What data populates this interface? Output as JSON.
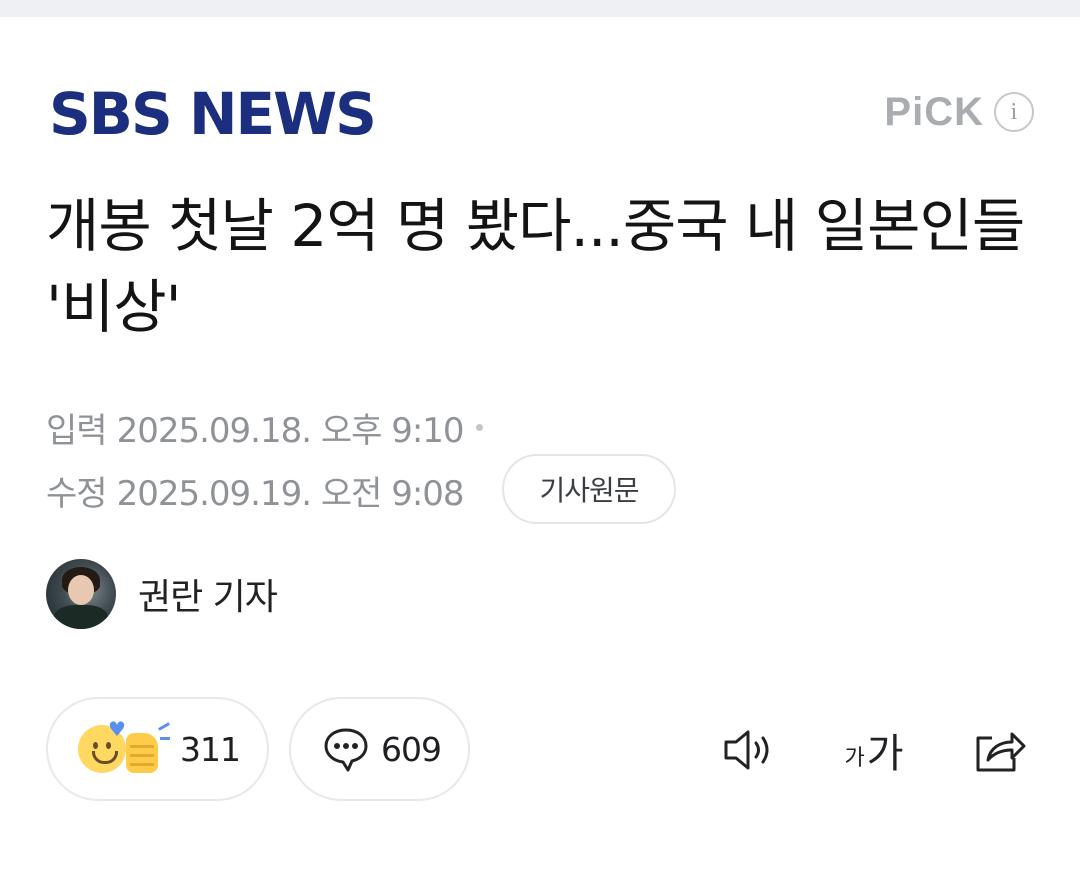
{
  "header": {
    "brand": "SBS NEWS",
    "pick_label": "PiCK",
    "info_icon_char": "i"
  },
  "article": {
    "title": "개봉 첫날 2억 명 봤다...중국 내 일본인들 '비상'",
    "published_label": "입력",
    "published_at": "2025.09.18. 오후 9:10",
    "modified_label": "수정",
    "modified_at": "2025.09.19. 오전 9:08",
    "original_button": "기사원문"
  },
  "reporter": {
    "name": "권란 기자"
  },
  "actions": {
    "like_count": "311",
    "comment_count": "609",
    "font_size_small": "가",
    "font_size_large": "가"
  },
  "colors": {
    "brand": "#1b2f7e",
    "meta_text": "#8f9398",
    "border": "#e6e8eb"
  }
}
